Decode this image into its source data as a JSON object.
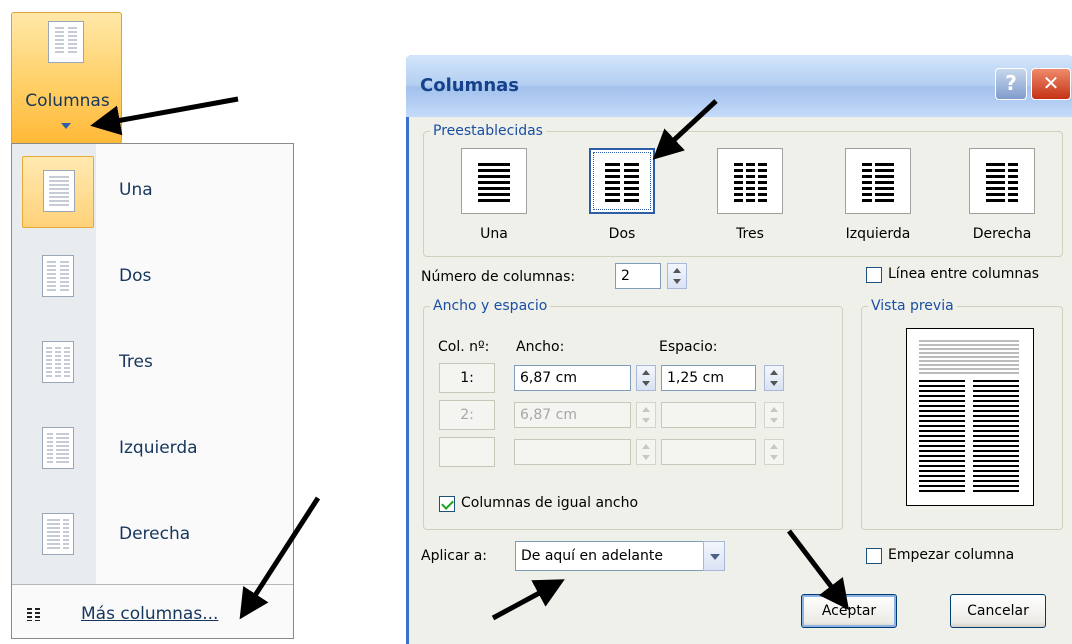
{
  "ribbon": {
    "button_label": "Columnas"
  },
  "menu": {
    "items": [
      {
        "label": "Una",
        "icon": "one-column-icon",
        "selected": true
      },
      {
        "label": "Dos",
        "icon": "two-columns-icon",
        "selected": false
      },
      {
        "label": "Tres",
        "icon": "three-columns-icon",
        "selected": false
      },
      {
        "label": "Izquierda",
        "icon": "left-column-icon",
        "selected": false
      },
      {
        "label": "Derecha",
        "icon": "right-column-icon",
        "selected": false
      }
    ],
    "more_label": "Más columnas..."
  },
  "dialog": {
    "title": "Columnas",
    "help_symbol": "?",
    "close_symbol": "✕",
    "presets_legend": "Preestablecidas",
    "presets": [
      {
        "label": "Una",
        "selected": false
      },
      {
        "label": "Dos",
        "selected": true
      },
      {
        "label": "Tres",
        "selected": false
      },
      {
        "label": "Izquierda",
        "selected": false
      },
      {
        "label": "Derecha",
        "selected": false
      }
    ],
    "num_columns_label": "Número de columnas:",
    "num_columns_value": "2",
    "line_between_label": "Línea entre columnas",
    "line_between_checked": false,
    "width_spacing_legend": "Ancho y espacio",
    "col_header": "Col. nº:",
    "width_header": "Ancho:",
    "spacing_header": "Espacio:",
    "rows": [
      {
        "col": "1:",
        "width": "6,87 cm",
        "spacing": "1,25 cm",
        "enabled": true
      },
      {
        "col": "2:",
        "width": "6,87 cm",
        "spacing": "",
        "enabled": false
      },
      {
        "col": "",
        "width": "",
        "spacing": "",
        "enabled": false
      }
    ],
    "equal_width_label": "Columnas de igual ancho",
    "equal_width_checked": true,
    "preview_legend": "Vista previa",
    "apply_label": "Aplicar a:",
    "apply_value": "De aquí en adelante",
    "start_column_label": "Empezar columna",
    "start_column_checked": false,
    "ok_label": "Aceptar",
    "cancel_label": "Cancelar"
  },
  "colors": {
    "accent": "#3b71cc",
    "title_text": "#15428b",
    "legend_text": "#1a4ea3",
    "highlight": "#ffd067"
  }
}
